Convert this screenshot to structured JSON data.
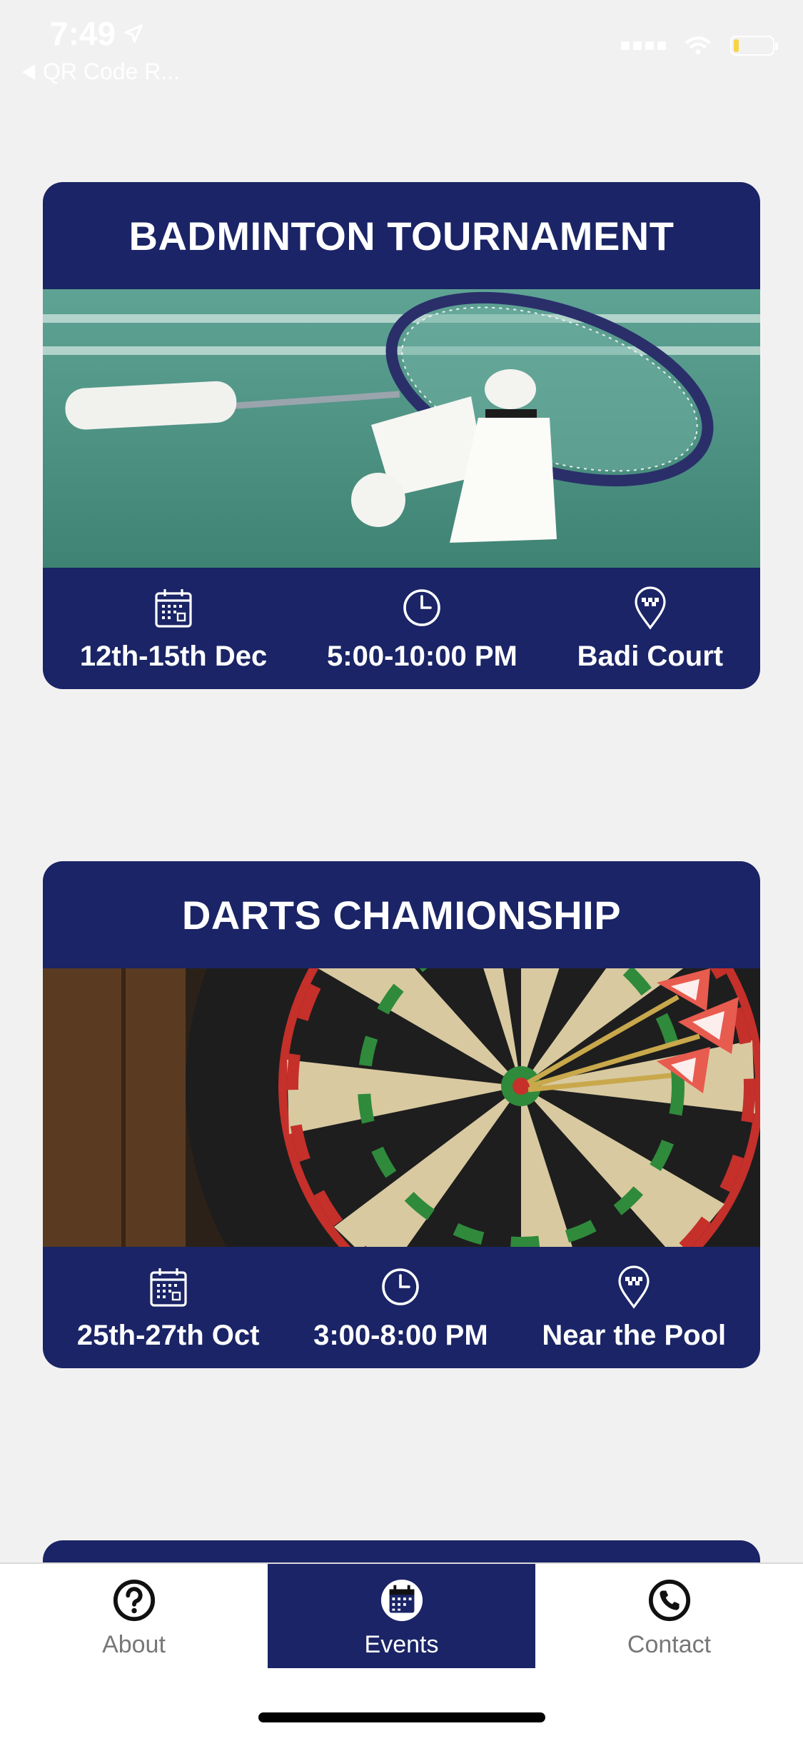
{
  "status_bar": {
    "time": "7:49",
    "back_label": "QR Code R..."
  },
  "events": [
    {
      "title": "BADMINTON TOURNAMENT",
      "date": "12th-15th Dec",
      "time": "5:00-10:00 PM",
      "location": "Badi Court",
      "image": "badminton-racket-and-shuttlecocks"
    },
    {
      "title": "DARTS CHAMIONSHIP",
      "date": "25th-27th Oct",
      "time": "3:00-8:00 PM",
      "location": "Near the Pool",
      "image": "dartboard-with-darts"
    }
  ],
  "tabs": [
    {
      "label": "About",
      "icon": "question-circle-icon",
      "active": false
    },
    {
      "label": "Events",
      "icon": "calendar-icon",
      "active": true
    },
    {
      "label": "Contact",
      "icon": "phone-icon",
      "active": false
    }
  ],
  "colors": {
    "brand_navy": "#1a2466",
    "background": "#f2f1f2",
    "tab_inactive": "#777777",
    "battery_low": "#f6d443"
  }
}
